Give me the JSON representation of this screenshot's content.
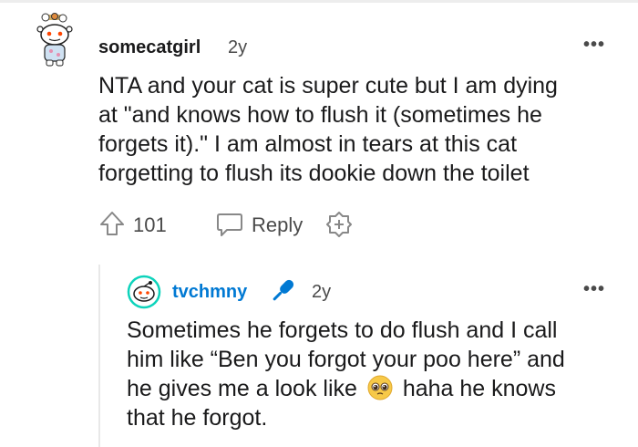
{
  "comment": {
    "username": "somecatgirl",
    "age": "2y",
    "more": "•••",
    "body": "NTA and your cat is super cute but I am dying\nat \"and knows how to flush it (sometimes he\nforgets it).\" I am almost in tears at this cat\nforgetting to flush its dookie down the toilet",
    "upvotes": "101",
    "reply_label": "Reply"
  },
  "reply": {
    "username": "tvchmny",
    "age": "2y",
    "more": "•••",
    "line1": "Sometimes he forgets to do flush and I call",
    "line2": "him like “Ben you forgot your poo here” and",
    "line3_a": "he gives me a look like",
    "line3_b": "haha he knows",
    "line4": "that he forgot."
  },
  "colors": {
    "text": "#1a1a1b",
    "meta": "#4a4a4a",
    "reply_username": "#0079d3",
    "thread_line": "#e8e8e8"
  }
}
